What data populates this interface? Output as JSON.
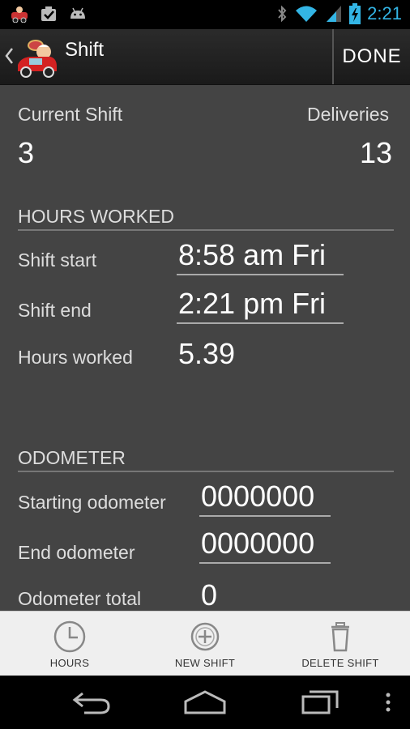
{
  "status_bar": {
    "time": "2:21",
    "left_icons": [
      "app-notification-icon",
      "task-icon",
      "android-icon"
    ],
    "right_icons": [
      "bluetooth-icon",
      "wifi-icon",
      "signal-icon",
      "battery-charging-icon"
    ]
  },
  "action_bar": {
    "title": "Shift",
    "done_label": "DONE"
  },
  "summary": {
    "current_shift_label": "Current Shift",
    "current_shift_value": "3",
    "deliveries_label": "Deliveries",
    "deliveries_value": "13"
  },
  "hours_worked": {
    "section_title": "HOURS WORKED",
    "shift_start_label": "Shift start",
    "shift_start_value": "8:58 am Fri",
    "shift_end_label": "Shift end",
    "shift_end_value": "2:21 pm Fri",
    "hours_worked_label": "Hours worked",
    "hours_worked_value": "5.39"
  },
  "odometer": {
    "section_title": "ODOMETER",
    "starting_label": "Starting odometer",
    "starting_value": "0000000",
    "end_label": "End odometer",
    "end_value": "0000000",
    "total_label": "Odometer total",
    "total_value": "0"
  },
  "toolbar": {
    "hours_label": "HOURS",
    "new_shift_label": "NEW SHIFT",
    "delete_shift_label": "DELETE SHIFT"
  },
  "colors": {
    "accent": "#33b5e5",
    "background": "#444444",
    "toolbar": "#efefef"
  }
}
